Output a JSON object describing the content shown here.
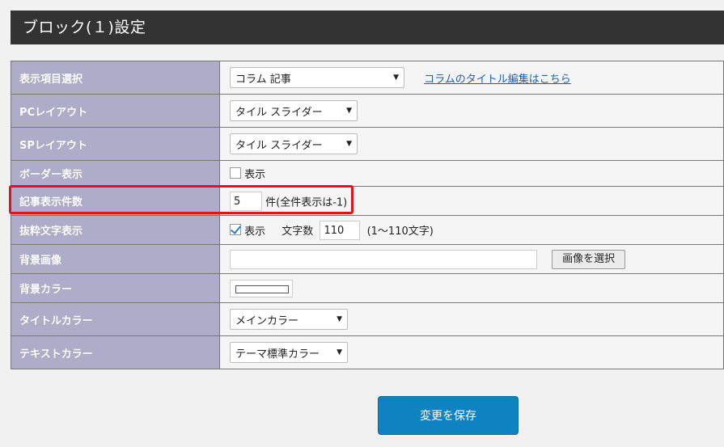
{
  "header": {
    "title": "ブロック(１)設定"
  },
  "rows": {
    "display_item": {
      "label": "表示項目選択",
      "select_value": "コラム 記事",
      "link": "コラムのタイトル編集はこちら"
    },
    "pc_layout": {
      "label": "PCレイアウト",
      "select_value": "タイル スライダー"
    },
    "sp_layout": {
      "label": "SPレイアウト",
      "select_value": "タイル スライダー"
    },
    "border": {
      "label": "ボーダー表示",
      "checkbox_label": "表示",
      "checked": false
    },
    "article_count": {
      "label": "記事表示件数",
      "value": "5",
      "suffix": "件(全件表示は-1)"
    },
    "excerpt": {
      "label": "抜粋文字表示",
      "checkbox_label": "表示",
      "checked": true,
      "chars_label": "文字数",
      "chars_value": "110",
      "chars_hint": "(1〜110文字)"
    },
    "bg_image": {
      "label": "背景画像",
      "value": "",
      "button": "画像を選択"
    },
    "bg_color": {
      "label": "背景カラー",
      "color": "#ffffff"
    },
    "title_color": {
      "label": "タイトルカラー",
      "select_value": "メインカラー"
    },
    "text_color": {
      "label": "テキストカラー",
      "select_value": "テーマ標準カラー"
    }
  },
  "save_button": "変更を保存",
  "colors": {
    "header_bg": "#333333",
    "label_bg": "#aeadc9",
    "accent": "#0f83c2",
    "highlight": "#e1141b"
  }
}
